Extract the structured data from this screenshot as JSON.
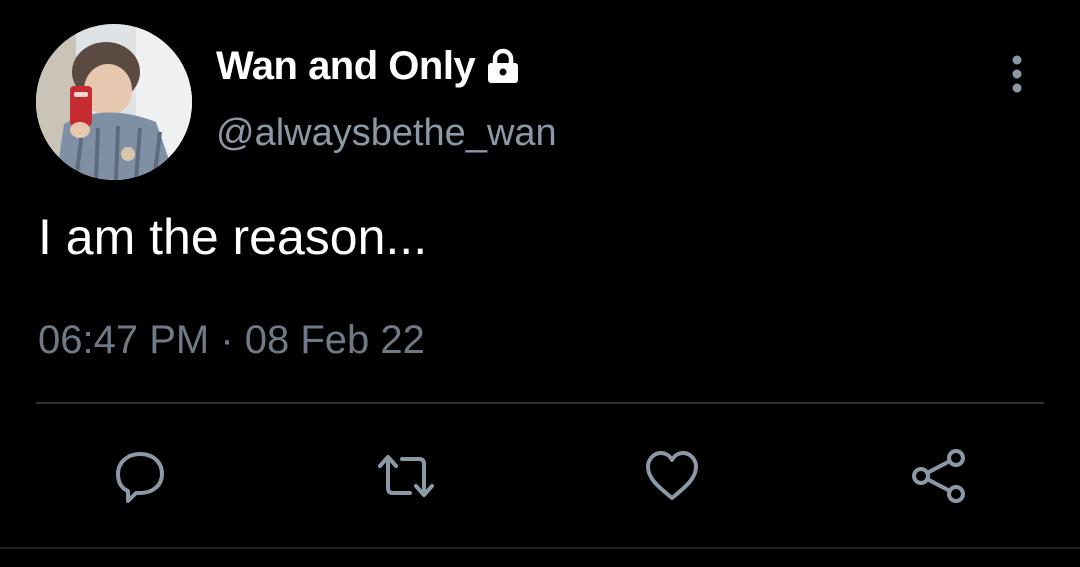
{
  "tweet": {
    "display_name": "Wan and Only",
    "handle": "@alwaysbethe_wan",
    "text": "I am the reason...",
    "timestamp": "06:47 PM · 08 Feb 22",
    "protected": true
  },
  "icons": {
    "lock": "lock-icon",
    "more": "more-vertical-icon",
    "reply": "reply-bubble-icon",
    "retweet": "retweet-icon",
    "like": "heart-icon",
    "share": "share-icon"
  },
  "colors": {
    "background": "#000000",
    "primary_text": "#ffffff",
    "secondary_text": "#8b98a5",
    "icon": "#8b98a5",
    "divider": "#2f3336"
  }
}
